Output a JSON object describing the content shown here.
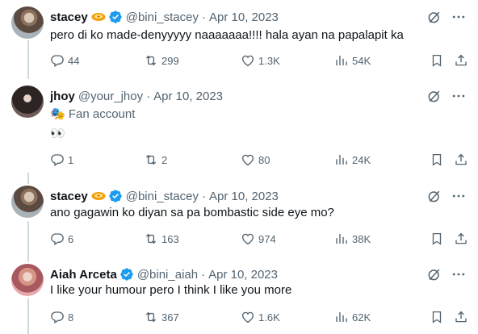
{
  "tweets": [
    {
      "name": "stacey",
      "handle": "@bini_stacey",
      "date": "Apr 10, 2023",
      "text": "pero di ko made-denyyyyy naaaaaaa!!!! hala ayan na papalapit ka",
      "replies": "44",
      "retweets": "299",
      "likes": "1.3K",
      "views": "54K"
    },
    {
      "name": "jhoy",
      "handle": "@your_jhoy",
      "date": "Apr 10, 2023",
      "bio_emoji": "🎭",
      "bio": "Fan account",
      "text": "👀",
      "replies": "1",
      "retweets": "2",
      "likes": "80",
      "views": "24K"
    },
    {
      "name": "stacey",
      "handle": "@bini_stacey",
      "date": "Apr 10, 2023",
      "text": "ano gagawin ko diyan sa pa bombastic side eye mo?",
      "replies": "6",
      "retweets": "163",
      "likes": "974",
      "views": "38K"
    },
    {
      "name": "Aiah Arceta",
      "handle": "@bini_aiah",
      "date": "Apr 10, 2023",
      "text": "I like your humour pero I think I like you more",
      "replies": "8",
      "retweets": "367",
      "likes": "1.6K",
      "views": "62K"
    }
  ],
  "colors": {
    "text": "#0f1419",
    "muted": "#536471",
    "verified": "#1d9bf0",
    "thread_line": "#cfd9de",
    "badge": "#f59e0b"
  },
  "icons": [
    "reply-icon",
    "retweet-icon",
    "like-icon",
    "views-icon",
    "bookmark-icon",
    "share-icon",
    "grok-icon",
    "more-icon",
    "verified-icon",
    "disc-badge-icon"
  ]
}
